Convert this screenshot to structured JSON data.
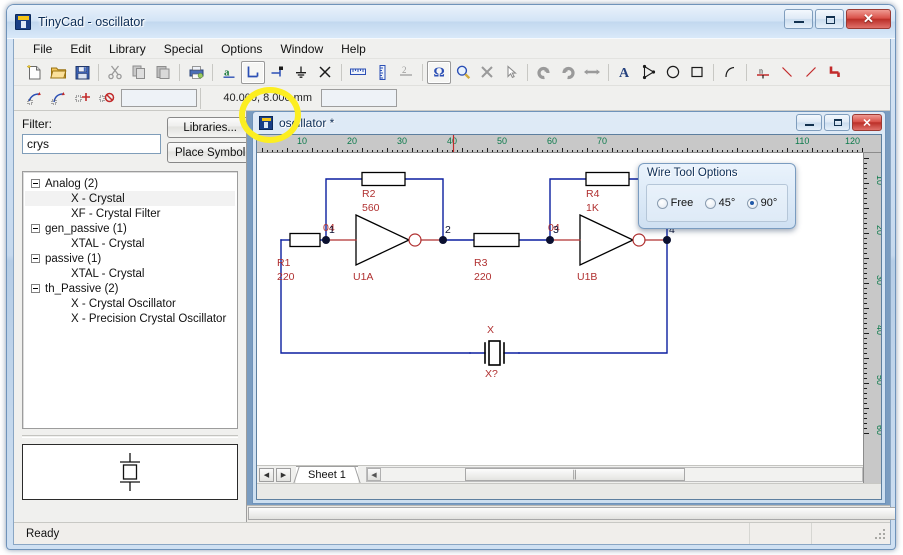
{
  "window": {
    "title": "TinyCad - oscillator",
    "icon": "tinycad-icon",
    "minimize_label": "Minimize",
    "maximize_label": "Maximize",
    "close_label": "✕"
  },
  "menubar": {
    "items": [
      "File",
      "Edit",
      "Library",
      "Special",
      "Options",
      "Window",
      "Help"
    ]
  },
  "toolbar1": {
    "buttons": [
      {
        "name": "new-file-button",
        "icon": "new-document-icon",
        "active": false
      },
      {
        "name": "open-file-button",
        "icon": "open-folder-icon",
        "active": false
      },
      {
        "name": "save-file-button",
        "icon": "floppy-save-icon",
        "active": false
      },
      {
        "name": "cut-button",
        "icon": "scissors-icon",
        "active": false
      },
      {
        "name": "copy-button",
        "icon": "copy-icon",
        "active": false
      },
      {
        "name": "paste-button",
        "icon": "paste-icon",
        "active": false
      },
      {
        "name": "print-button",
        "icon": "printer-icon",
        "active": false
      },
      {
        "name": "annotate-button",
        "icon": "letter-a-icon",
        "active": false
      },
      {
        "name": "wire-tool-button",
        "icon": "wire-tool-icon",
        "active": true
      },
      {
        "name": "bus-tool-button",
        "icon": "bus-pin-icon",
        "active": false
      },
      {
        "name": "ground-button",
        "icon": "ground-symbol-icon",
        "active": false
      },
      {
        "name": "no-connect-button",
        "icon": "cross-x-icon",
        "active": false
      },
      {
        "name": "ruler-button",
        "icon": "ruler-icon",
        "active": false
      },
      {
        "name": "vertical-ruler-button",
        "icon": "vertical-ruler-icon",
        "active": false
      },
      {
        "name": "power-label-button",
        "icon": "net-number-icon",
        "active": false
      },
      {
        "name": "netlist-button",
        "icon": "omega-icon",
        "active": true
      },
      {
        "name": "zoom-button",
        "icon": "magnifier-icon",
        "active": false
      },
      {
        "name": "delete-button",
        "icon": "x-delete-icon",
        "active": false
      },
      {
        "name": "select-button",
        "icon": "arrow-cursor-icon",
        "active": false
      },
      {
        "name": "rotate-left-button",
        "icon": "rotate-left-icon",
        "active": false
      },
      {
        "name": "rotate-right-button",
        "icon": "rotate-right-icon",
        "active": false
      },
      {
        "name": "flip-button",
        "icon": "flip-horizontal-icon",
        "active": false
      },
      {
        "name": "text-button",
        "icon": "bold-a-icon",
        "active": false
      },
      {
        "name": "polygon-button",
        "icon": "polygon-icon",
        "active": false
      },
      {
        "name": "ellipse-button",
        "icon": "ellipse-icon",
        "active": false
      },
      {
        "name": "rectangle-button",
        "icon": "rectangle-icon",
        "active": false
      },
      {
        "name": "arc-button",
        "icon": "arc-icon",
        "active": false
      },
      {
        "name": "junction-button",
        "icon": "junction-icon",
        "active": false
      },
      {
        "name": "line-button",
        "icon": "line-icon",
        "active": false
      },
      {
        "name": "line2-button",
        "icon": "line-diagonal-icon",
        "active": false
      },
      {
        "name": "polyline-button",
        "icon": "polyline-red-icon",
        "active": false
      }
    ]
  },
  "toolbar2": {
    "buttons": [
      {
        "name": "design-rule-check-button",
        "icon": "drc-icon"
      },
      {
        "name": "design-rule-check-2-button",
        "icon": "drc-alt-icon"
      },
      {
        "name": "add-annotate-button",
        "icon": "add-plus-icon"
      },
      {
        "name": "undo-annotate-button",
        "icon": "undo-annotate-icon"
      }
    ],
    "coordinate": "40.000,  8.000 mm"
  },
  "left_panel": {
    "filter_label": "Filter:",
    "filter_value": "crys",
    "filter_placeholder": "",
    "libraries_button": "Libraries...",
    "place_symbol_button": "Place Symbol",
    "tree": [
      {
        "type": "group",
        "label": "Analog (2)"
      },
      {
        "type": "child",
        "label": "X - Crystal",
        "selected": true
      },
      {
        "type": "child",
        "label": "XF - Crystal Filter",
        "selected": false
      },
      {
        "type": "group",
        "label": "gen_passive (1)"
      },
      {
        "type": "child",
        "label": "XTAL - Crystal",
        "selected": false
      },
      {
        "type": "group",
        "label": "passive (1)"
      },
      {
        "type": "child",
        "label": "XTAL - Crystal",
        "selected": false
      },
      {
        "type": "group",
        "label": "th_Passive (2)"
      },
      {
        "type": "child",
        "label": "X - Crystal Oscillator",
        "selected": false
      },
      {
        "type": "child",
        "label": "X - Precision Crystal Oscillator",
        "selected": false
      }
    ],
    "preview_symbol": "crystal-symbol"
  },
  "document": {
    "title": "oscillator *",
    "icon": "tinycad-icon",
    "minimize_label": "Minimize",
    "maximize_label": "Restore",
    "close_label": "✕",
    "sheet_tab": "Sheet 1",
    "prev_sheet_icon": "left-triangle-icon",
    "next_sheet_icon": "right-triangle-icon",
    "ruler": {
      "h_labels": [
        10,
        20,
        30,
        40,
        50,
        60,
        70,
        110,
        120
      ],
      "v_labels": [
        10,
        20,
        30,
        40,
        50,
        60
      ],
      "units": "mm",
      "cursor_mark": 40
    }
  },
  "schematic": {
    "components": [
      {
        "ref": "R1",
        "value": "220",
        "type": "resistor"
      },
      {
        "ref": "R2",
        "value": "560",
        "type": "resistor"
      },
      {
        "ref": "R3",
        "value": "220",
        "type": "resistor"
      },
      {
        "ref": "R4",
        "value": "1K",
        "type": "resistor"
      },
      {
        "ref": "U1A",
        "value": "04",
        "type": "inverter"
      },
      {
        "ref": "U1B",
        "value": "04",
        "type": "inverter"
      },
      {
        "ref": "X",
        "value": "X?",
        "type": "crystal"
      }
    ],
    "nodes": [
      "1",
      "2",
      "3",
      "4"
    ],
    "wire_color": "#0b1fa0",
    "symbol_color": "#000000",
    "label_color": "#b03030"
  },
  "wire_dialog": {
    "title": "Wire Tool Options",
    "options": [
      {
        "label": "Free",
        "selected": false
      },
      {
        "label": "45°",
        "selected": false
      },
      {
        "label": "90°",
        "selected": true
      }
    ]
  },
  "statusbar": {
    "text": "Ready"
  }
}
